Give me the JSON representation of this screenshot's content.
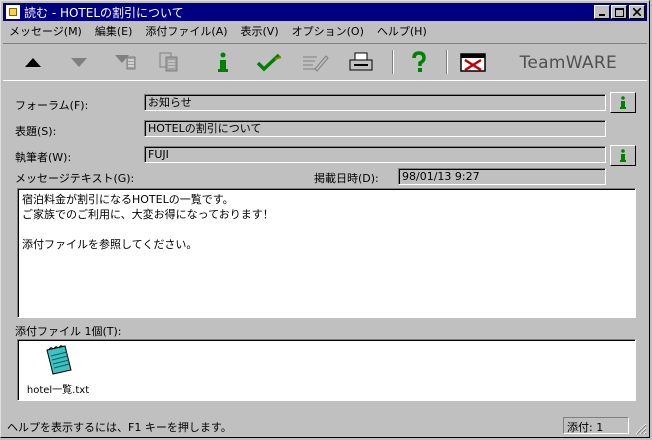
{
  "window": {
    "title": "読む - HOTELの割引について",
    "controls": [
      "minimize",
      "maximize",
      "close"
    ]
  },
  "menu": [
    {
      "label": "メッセージ(M)"
    },
    {
      "label": "編集(E)"
    },
    {
      "label": "添付ファイル(A)"
    },
    {
      "label": "表示(V)"
    },
    {
      "label": "オプション(O)"
    },
    {
      "label": "ヘルプ(H)"
    }
  ],
  "toolbar": {
    "brand": "TeamWARE",
    "tools": [
      "up-arrow-icon",
      "down-arrow-icon",
      "next-unread-icon",
      "copy-icon",
      "info-icon",
      "check-icon",
      "edit-icon",
      "print-icon",
      "help-icon",
      "delete-icon"
    ],
    "colors": {
      "info": "#008000",
      "check": "#008000",
      "help": "#008000",
      "delete": "#c00000"
    }
  },
  "form": {
    "form_label": "フォーラム(F):",
    "form_value": "お知らせ",
    "subject_label": "表題(S):",
    "subject_value": "HOTELの割引について",
    "author_label": "執筆者(W):",
    "author_value": "FUJI",
    "message_label": "メッセージテキスト(G):",
    "date_label": "掲載日時(D):",
    "date_value": "98/01/13  9:27"
  },
  "message": {
    "lines": [
      "宿泊料金が割引になるHOTELの一覧です。",
      "ご家族でのご利用に、大変お得になっております！",
      "",
      "添付ファイルを参照してください。"
    ]
  },
  "attachments": {
    "label": "添付ファイル 1個(T):",
    "files": [
      {
        "name": "hotel一覧.txt",
        "icon": "text-file-icon"
      }
    ]
  },
  "status": {
    "message": "ヘルプを表示するには、F1 キーを押します。",
    "count": "添付: 1"
  }
}
